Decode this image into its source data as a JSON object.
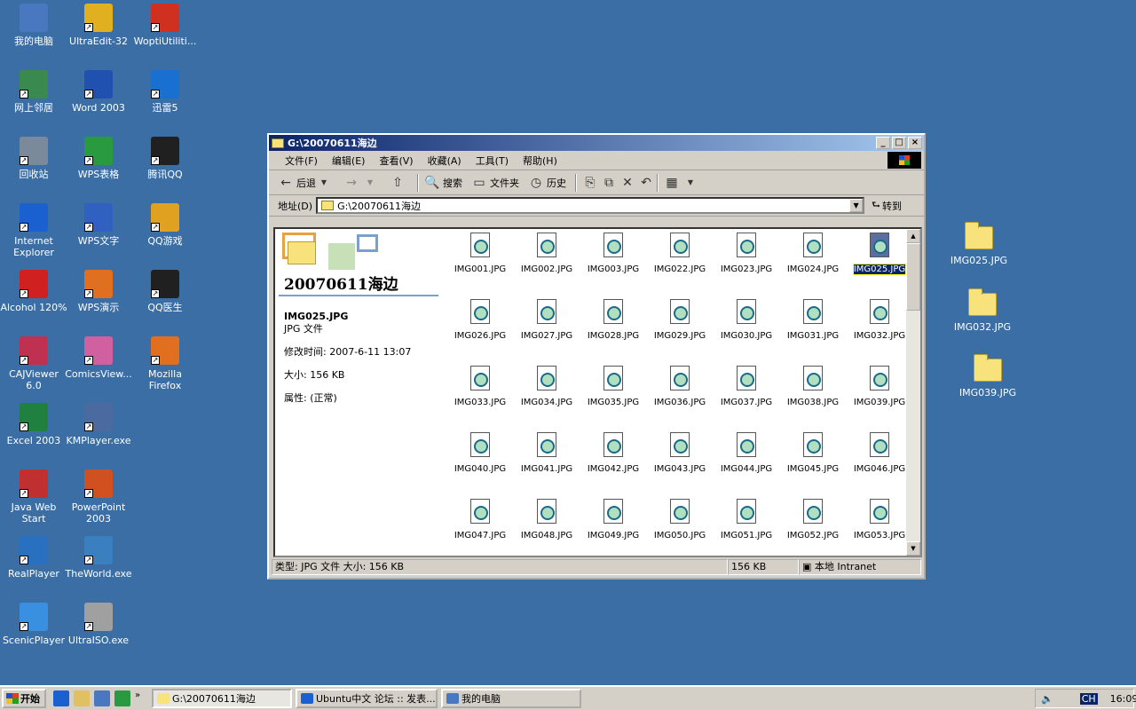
{
  "desktop_icons": [
    {
      "name": "my-computer",
      "label": "我的电脑",
      "color": "#4a78c0"
    },
    {
      "name": "ultraedit",
      "label": "UltraEdit-32",
      "color": "#e0b020"
    },
    {
      "name": "woptiutilities",
      "label": "WoptiUtiliti...",
      "color": "#d03020"
    },
    {
      "name": "network",
      "label": "网上邻居",
      "color": "#3a8a50"
    },
    {
      "name": "word-2003",
      "label": "Word 2003",
      "color": "#2050b0"
    },
    {
      "name": "xunlei",
      "label": "迅雷5",
      "color": "#1a70d0"
    },
    {
      "name": "recycle-bin",
      "label": "回收站",
      "color": "#7a8a9a"
    },
    {
      "name": "wps-sheet",
      "label": "WPS表格",
      "color": "#2a9a40"
    },
    {
      "name": "tencent-qq",
      "label": "腾讯QQ",
      "color": "#202020"
    },
    {
      "name": "ie",
      "label": "Internet Explorer",
      "color": "#1a60d0"
    },
    {
      "name": "wps-writer",
      "label": "WPS文字",
      "color": "#3060c0"
    },
    {
      "name": "qq-game",
      "label": "QQ游戏",
      "color": "#e0a020"
    },
    {
      "name": "alcohol",
      "label": "Alcohol 120%",
      "color": "#d02020"
    },
    {
      "name": "wps-present",
      "label": "WPS演示",
      "color": "#e07020"
    },
    {
      "name": "qq-doctor",
      "label": "QQ医生",
      "color": "#202020"
    },
    {
      "name": "cajviewer",
      "label": "CAJViewer 6.0",
      "color": "#c03050"
    },
    {
      "name": "comicsviewer",
      "label": "ComicsView...",
      "color": "#d060a0"
    },
    {
      "name": "firefox",
      "label": "Mozilla Firefox",
      "color": "#e07020"
    },
    {
      "name": "excel-2003",
      "label": "Excel 2003",
      "color": "#208040"
    },
    {
      "name": "kmplayer",
      "label": "KMPlayer.exe",
      "color": "#4a6aa0"
    },
    {
      "name": "java-web-start",
      "label": "Java Web Start",
      "color": "#c03030"
    },
    {
      "name": "powerpoint-2003",
      "label": "PowerPoint 2003",
      "color": "#d05020"
    },
    {
      "name": "realplayer",
      "label": "RealPlayer",
      "color": "#2a70c0"
    },
    {
      "name": "theworld",
      "label": "TheWorld.exe",
      "color": "#3a80c0"
    },
    {
      "name": "scenicplayer",
      "label": "ScenicPlayer",
      "color": "#3a90e0"
    },
    {
      "name": "ultraiso",
      "label": "UltraISO.exe",
      "color": "#a0a0a0"
    }
  ],
  "right_folders": [
    {
      "label": "IMG025.JPG"
    },
    {
      "label": "IMG032.JPG"
    },
    {
      "label": "IMG039.JPG"
    }
  ],
  "window": {
    "title": "G:\\20070611海边",
    "menu": [
      "文件(F)",
      "编辑(E)",
      "查看(V)",
      "收藏(A)",
      "工具(T)",
      "帮助(H)"
    ],
    "toolbar": {
      "back": "后退",
      "search": "搜索",
      "folders": "文件夹",
      "history": "历史"
    },
    "address": {
      "label": "地址(D)",
      "value": "G:\\20070611海边",
      "go": "转到"
    },
    "left_pane": {
      "folder_title": "20070611海边",
      "file_name": "IMG025.JPG",
      "file_type": "JPG 文件",
      "modified": "修改时间: 2007-6-11 13:07",
      "size": "大小: 156 KB",
      "attributes": "属性: (正常)"
    },
    "files": [
      "IMG001.JPG",
      "IMG002.JPG",
      "IMG003.JPG",
      "IMG022.JPG",
      "IMG023.JPG",
      "IMG024.JPG",
      "IMG025.JPG",
      "IMG026.JPG",
      "IMG027.JPG",
      "IMG028.JPG",
      "IMG029.JPG",
      "IMG030.JPG",
      "IMG031.JPG",
      "IMG032.JPG",
      "IMG033.JPG",
      "IMG034.JPG",
      "IMG035.JPG",
      "IMG036.JPG",
      "IMG037.JPG",
      "IMG038.JPG",
      "IMG039.JPG",
      "IMG040.JPG",
      "IMG041.JPG",
      "IMG042.JPG",
      "IMG043.JPG",
      "IMG044.JPG",
      "IMG045.JPG",
      "IMG046.JPG",
      "IMG047.JPG",
      "IMG048.JPG",
      "IMG049.JPG",
      "IMG050.JPG",
      "IMG051.JPG",
      "IMG052.JPG",
      "IMG053.JPG"
    ],
    "selected_file": "IMG025.JPG",
    "status": {
      "left": "类型: JPG 文件 大小: 156 KB",
      "size": "156 KB",
      "zone": "本地 Intranet"
    }
  },
  "taskbar": {
    "start": "开始",
    "tasks": [
      {
        "label": "G:\\20070611海边",
        "active": true
      },
      {
        "label": "Ubuntu中文 论坛 :: 发表...",
        "active": false
      },
      {
        "label": "我的电脑",
        "active": false
      }
    ],
    "lang": "CH",
    "clock": "16:09"
  }
}
